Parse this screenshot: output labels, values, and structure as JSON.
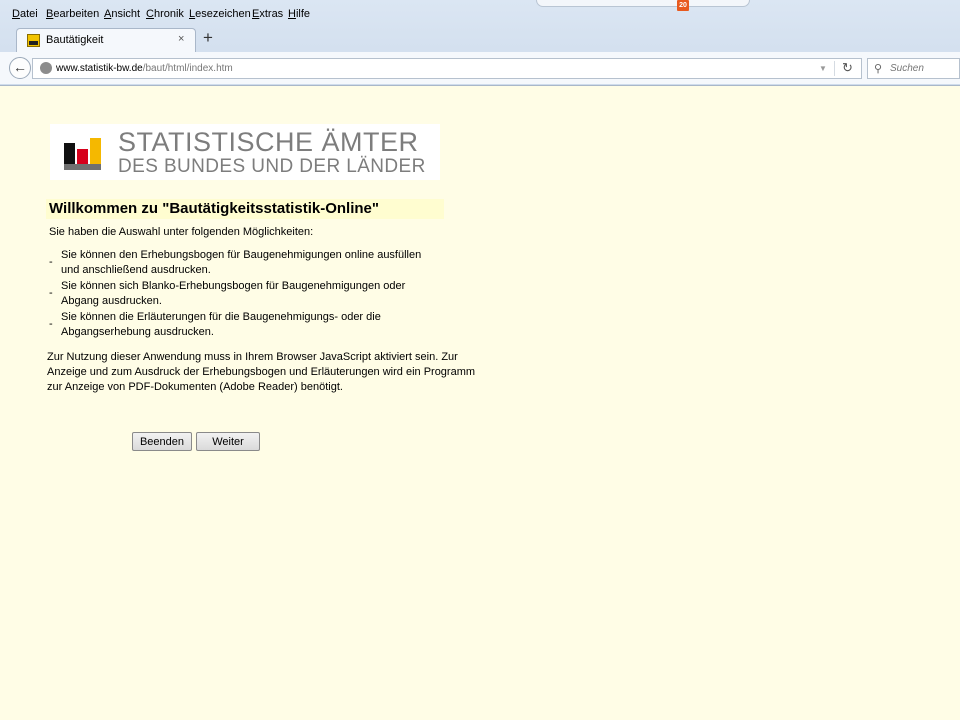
{
  "browser": {
    "menu": [
      "Datei",
      "Bearbeiten",
      "Ansicht",
      "Chronik",
      "Lesezeichen",
      "Extras",
      "Hilfe"
    ],
    "notification_count": "20",
    "tab": {
      "title": "Bautätigkeit",
      "close": "×"
    },
    "new_tab": "+",
    "url": {
      "host": "www.statistik-bw.de",
      "path": "/baut/html/index.htm"
    },
    "search_placeholder": "Suchen",
    "icons": [
      "back-arrow-icon",
      "globe-icon",
      "dropdown-icon",
      "reload-icon",
      "search-icon"
    ]
  },
  "page": {
    "logo": {
      "line1": "STATISTISCHE ÄMTER",
      "line2": "DES BUNDES UND DER LÄNDER",
      "colors": [
        "#111111",
        "#d6001c",
        "#f5b800"
      ]
    },
    "heading": "Willkommen zu \"Bautätigkeitsstatistik-Online\"",
    "intro": "Sie haben die Auswahl unter folgenden Möglichkeiten:",
    "options": [
      "Sie können den Erhebungsbogen für Baugenehmigungen online ausfüllen und anschließend ausdrucken.",
      "Sie können sich Blanko-Erhebungsbogen für Baugenehmigungen oder Abgang ausdrucken.",
      "Sie können die Erläuterungen für die Baugenehmigungs- oder die Abgangserhebung ausdrucken."
    ],
    "bullet": "-",
    "note": "Zur Nutzung dieser Anwendung muss in Ihrem Browser JavaScript aktiviert sein. Zur Anzeige und zum Ausdruck der Erhebungsbogen und Erläuterungen wird ein Programm zur Anzeige von PDF-Dokumenten (Adobe Reader) benötigt.",
    "buttons": {
      "quit": "Beenden",
      "next": "Weiter"
    },
    "background_color": "#fffde6"
  }
}
